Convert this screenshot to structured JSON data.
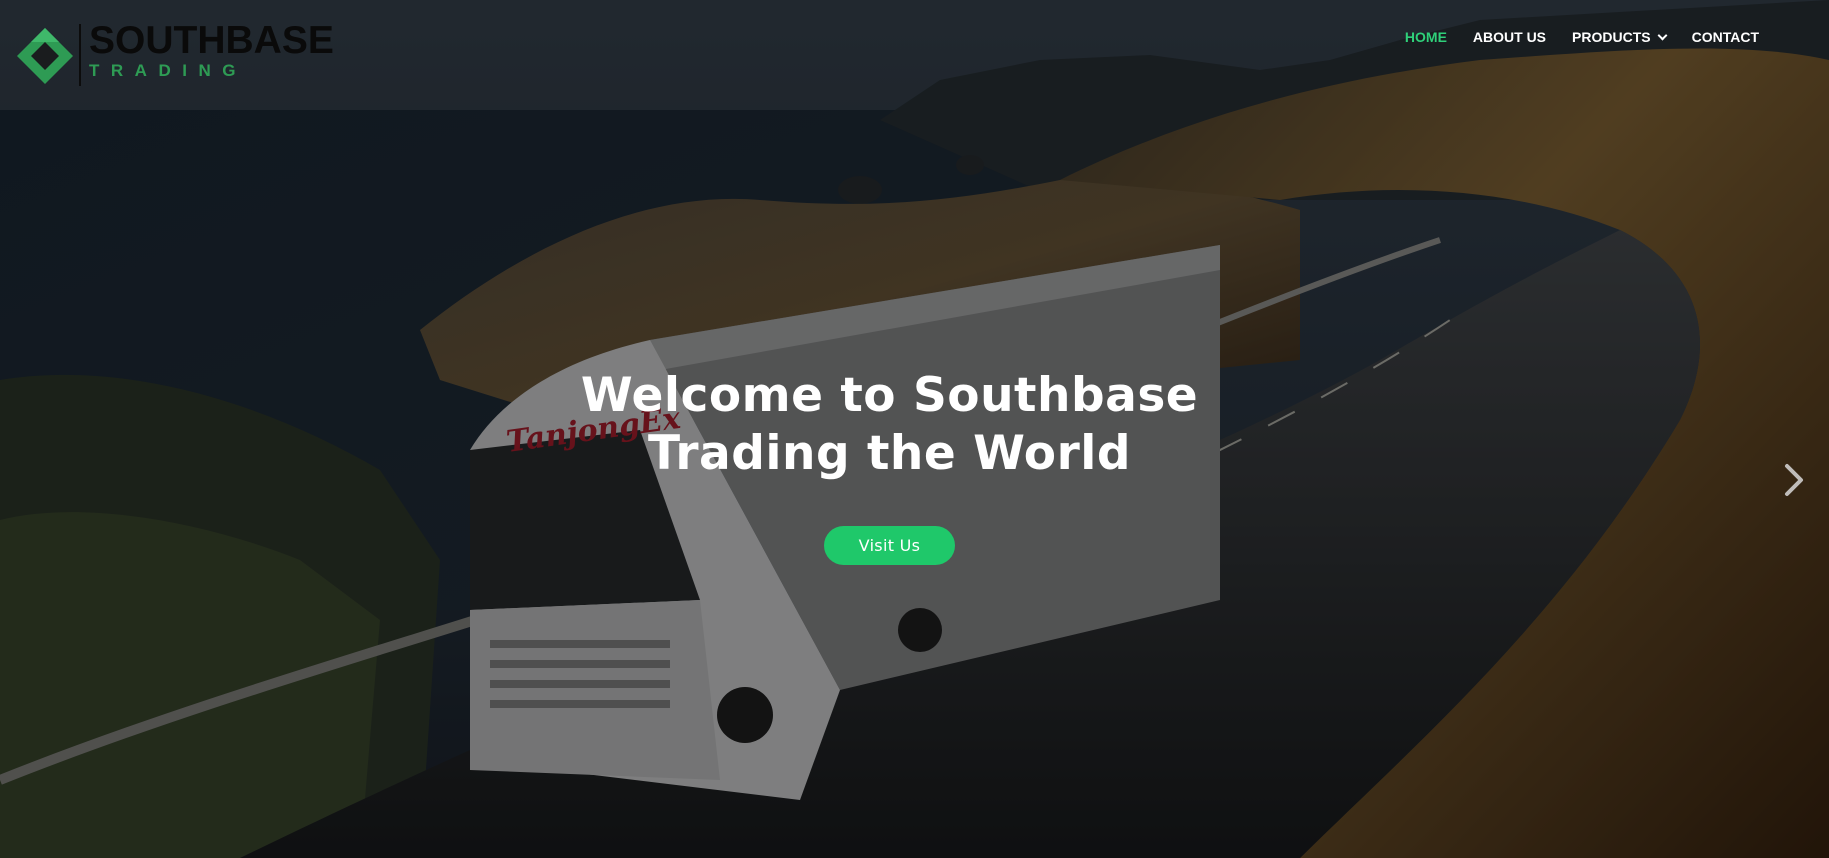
{
  "brand": {
    "name": "SOUTHBASE",
    "tagline": "TRADING",
    "accent_color": "#2fd07a",
    "logo_green": "#2e9b54"
  },
  "nav": {
    "items": [
      {
        "label": "HOME",
        "active": true
      },
      {
        "label": "ABOUT US",
        "active": false
      },
      {
        "label": "PRODUCTS",
        "active": false,
        "has_dropdown": true
      },
      {
        "label": "CONTACT",
        "active": false
      }
    ]
  },
  "hero": {
    "title_line1": "Welcome to Southbase",
    "title_line2": "Trading the World",
    "button_label": "Visit Us",
    "button_color": "#1fc86a",
    "truck_text": "TanjongEx"
  },
  "slider": {
    "next_icon": "chevron-right-icon"
  }
}
